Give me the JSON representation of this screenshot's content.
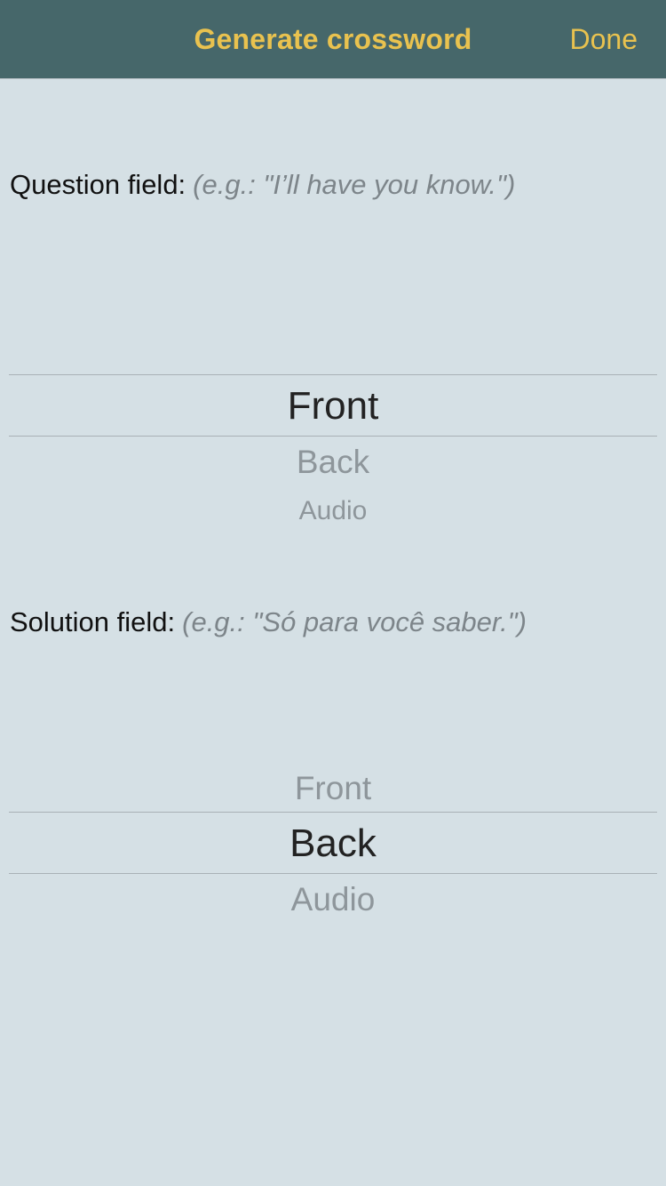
{
  "navbar": {
    "title": "Generate crossword",
    "done_label": "Done"
  },
  "question": {
    "label": "Question field:",
    "hint": "(e.g.: \"I’ll have you know.\")",
    "options": [
      "Front",
      "Back",
      "Audio"
    ],
    "selected": "Front"
  },
  "solution": {
    "label": "Solution field:",
    "hint": "(e.g.: \"Só para você saber.\")",
    "options": [
      "Front",
      "Back",
      "Audio"
    ],
    "selected": "Back"
  },
  "colors": {
    "navbar_bg": "#46676a",
    "accent": "#e9c24f",
    "page_bg": "#d5e0e5"
  }
}
